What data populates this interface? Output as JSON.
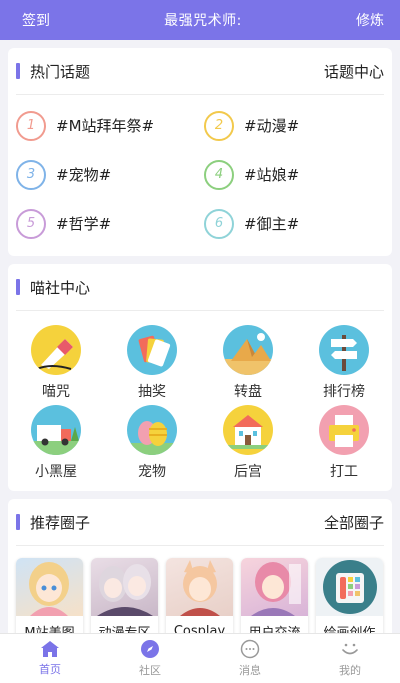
{
  "header": {
    "left": "签到",
    "title": "最强咒术师:",
    "right": "修炼"
  },
  "hot_topics": {
    "title": "热门话题",
    "link": "话题中心",
    "items": [
      {
        "num": "1",
        "text": "#M站拜年祭#",
        "color": "#f19b8f"
      },
      {
        "num": "2",
        "text": "#动漫#",
        "color": "#f2c94c"
      },
      {
        "num": "3",
        "text": "#宠物#",
        "color": "#7fb3e8"
      },
      {
        "num": "4",
        "text": "#站娘#",
        "color": "#8ccf7e"
      },
      {
        "num": "5",
        "text": "#哲学#",
        "color": "#c89bd8"
      },
      {
        "num": "6",
        "text": "#御主#",
        "color": "#8fd3d8"
      }
    ]
  },
  "center": {
    "title": "喵社中心",
    "items": [
      {
        "label": "喵咒",
        "icon": "eraser-icon",
        "bg": "#f5d23c"
      },
      {
        "label": "抽奖",
        "icon": "cards-icon",
        "bg": "#5bc0de"
      },
      {
        "label": "转盘",
        "icon": "pyramid-icon",
        "bg": "#5bc0de"
      },
      {
        "label": "排行榜",
        "icon": "signpost-icon",
        "bg": "#5bc0de"
      },
      {
        "label": "小黑屋",
        "icon": "truck-icon",
        "bg": "#5bc0de"
      },
      {
        "label": "宠物",
        "icon": "eggs-icon",
        "bg": "#5bc0de"
      },
      {
        "label": "后宫",
        "icon": "palace-icon",
        "bg": "#f5d23c"
      },
      {
        "label": "打工",
        "icon": "printer-icon",
        "bg": "#f2a0b0"
      }
    ]
  },
  "circles": {
    "title": "推荐圈子",
    "link": "全部圈子",
    "items": [
      {
        "label": "M站美图",
        "icon": "anime-girl-thumbnail"
      },
      {
        "label": "动漫专区",
        "icon": "anime-girls-thumbnail"
      },
      {
        "label": "Cosplay",
        "icon": "cosplay-thumbnail"
      },
      {
        "label": "用户交流",
        "icon": "anime-pink-thumbnail"
      },
      {
        "label": "绘画创作",
        "icon": "palette-icon"
      }
    ]
  },
  "tabbar": [
    {
      "label": "首页",
      "icon": "home-icon",
      "active": true
    },
    {
      "label": "社区",
      "icon": "compass-icon",
      "active": false
    },
    {
      "label": "消息",
      "icon": "chat-icon",
      "active": false
    },
    {
      "label": "我的",
      "icon": "smile-icon",
      "active": false
    }
  ],
  "colors": {
    "accent": "#7b74e8",
    "background": "#f2f2f7"
  }
}
